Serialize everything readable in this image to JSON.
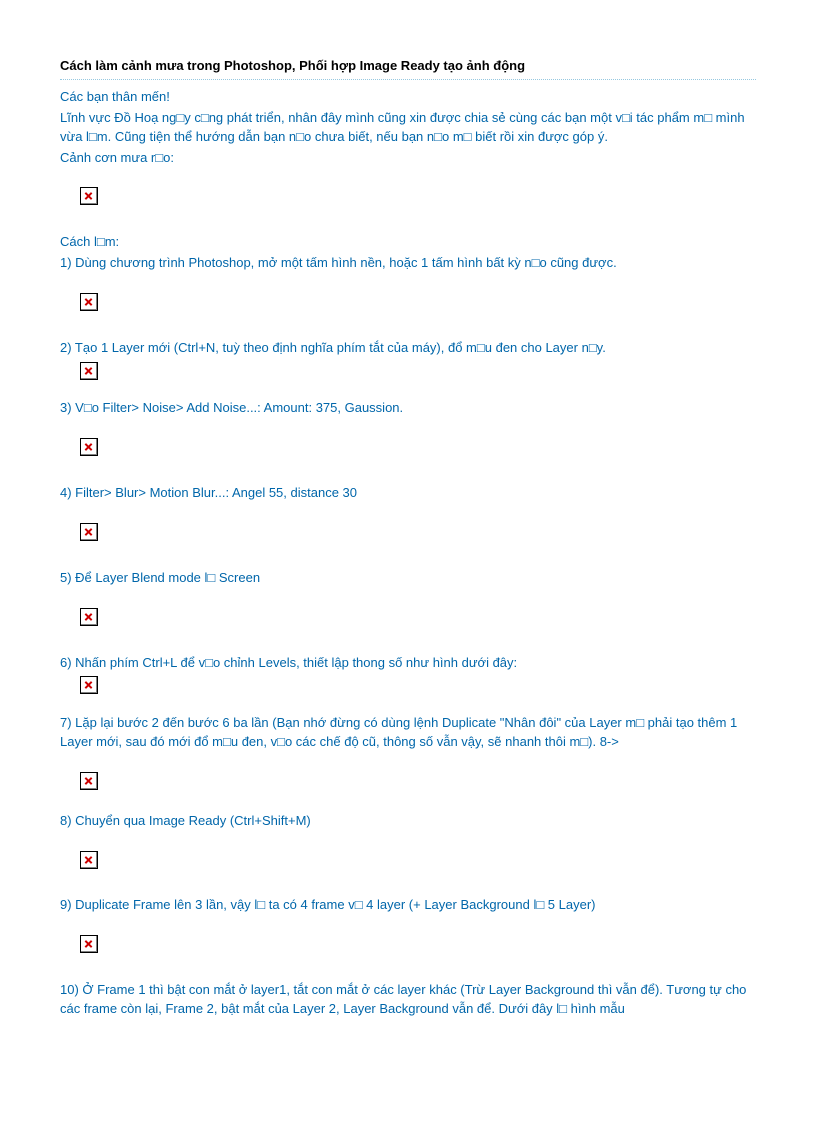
{
  "title": "Cách làm cảnh mưa trong Photoshop, Phối hợp Image Ready tạo ảnh động",
  "intro": {
    "line1": "Các bạn thân mến!",
    "line2": "Lĩnh vực Đồ Hoạ ng□y c□ng phát triển, nhân đây mình cũng xin được chia sẻ cùng các bạn một v□i tác phẩm m□ mình vừa l□m. Cũng tiện thể hướng dẫn bạn n□o chưa biết, nếu bạn n□o m□ biết rồi xin được góp ý.",
    "line3": "Cảnh cơn mưa r□o:"
  },
  "how_label": "Cách l□m:",
  "steps": {
    "s1": "1) Dùng chương trình Photoshop, mở một tấm hình nền, hoặc 1 tấm hình bất kỳ n□o cũng được.",
    "s2": "2) Tạo 1 Layer mới (Ctrl+N, tuỳ theo định nghĩa phím tắt của máy), đổ m□u đen cho Layer n□y.",
    "s3": "3) V□o Filter> Noise> Add Noise...: Amount: 375, Gaussion.",
    "s4": "4) Filter> Blur> Motion Blur...: Angel 55, distance 30",
    "s5": "5) Để Layer Blend mode l□ Screen",
    "s6": "6) Nhấn phím Ctrl+L để v□o chỉnh Levels, thiết lập thong số như hình dưới đây:",
    "s7": "7) Lặp lại bước 2 đến bước 6 ba lần (Bạn nhớ đừng có dùng lệnh Duplicate \"Nhân đôi\" của Layer m□ phải tạo thêm 1 Layer mới, sau đó mới đổ m□u đen, v□o các chế độ cũ, thông số vẫn vậy, sẽ nhanh thôi m□). 8->",
    "s8": "8) Chuyển qua Image Ready (Ctrl+Shift+M)",
    "s9": "9) Duplicate Frame lên 3 lần, vậy l□ ta có 4 frame v□ 4 layer (+ Layer Background l□ 5 Layer)",
    "s10": "10) Ở Frame 1 thì bật con mắt ở layer1, tắt con mắt ở các layer khác (Trừ Layer Background thì vẫn để). Tương tự cho các frame còn lại, Frame 2, bật mắt của Layer 2, Layer Background vẫn để. Dưới đây l□ hình mẫu"
  }
}
